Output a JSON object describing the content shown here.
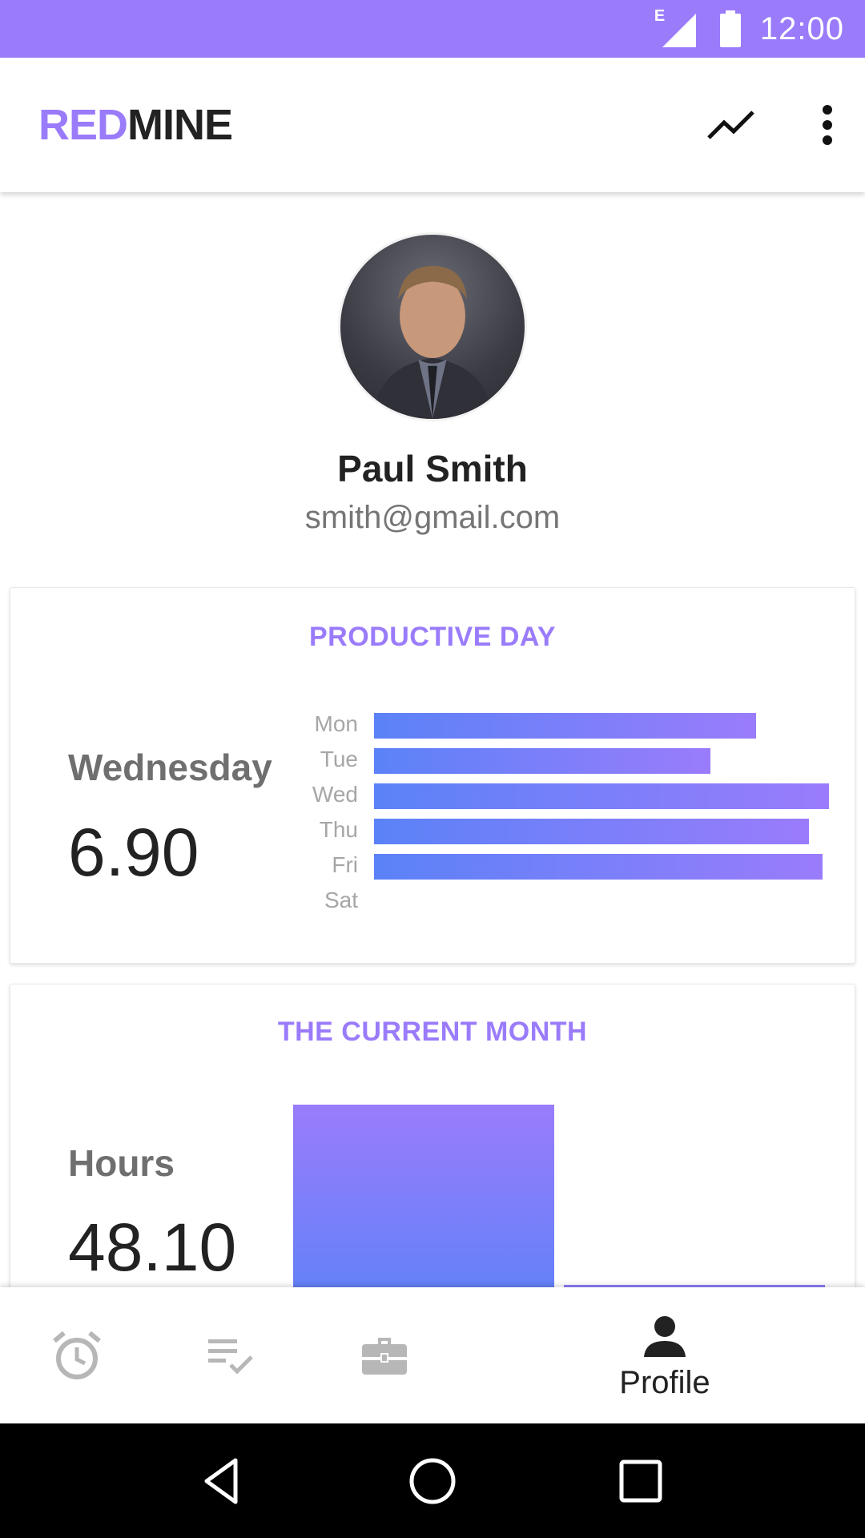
{
  "status_bar": {
    "network": "E",
    "time": "12:00"
  },
  "app_bar": {
    "logo_red": "RED",
    "logo_mine": "MINE",
    "trend_icon": "trending-up-icon",
    "menu_icon": "more-vert-icon"
  },
  "profile": {
    "name": "Paul Smith",
    "email": "smith@gmail.com"
  },
  "productive_day": {
    "title": "PRODUCTIVE DAY",
    "day": "Wednesday",
    "value": "6.90",
    "days": [
      "Mon",
      "Tue",
      "Wed",
      "Thu",
      "Fri",
      "Sat"
    ]
  },
  "current_month": {
    "title": "THE CURRENT MONTH",
    "label": "Hours",
    "value": "48.10"
  },
  "bottom_nav": {
    "profile_label": "Profile"
  },
  "colors": {
    "accent": "#9a7cfb",
    "bar_blue": "#5b82f8",
    "text_dark": "#222222"
  },
  "chart_data": [
    {
      "type": "bar",
      "orientation": "horizontal",
      "categories": [
        "Mon",
        "Tue",
        "Wed",
        "Thu",
        "Fri",
        "Sat"
      ],
      "values": [
        5.8,
        5.1,
        6.9,
        6.6,
        6.8,
        0
      ]
    },
    {
      "type": "bar",
      "values": [
        48.1,
        0.5
      ]
    }
  ]
}
